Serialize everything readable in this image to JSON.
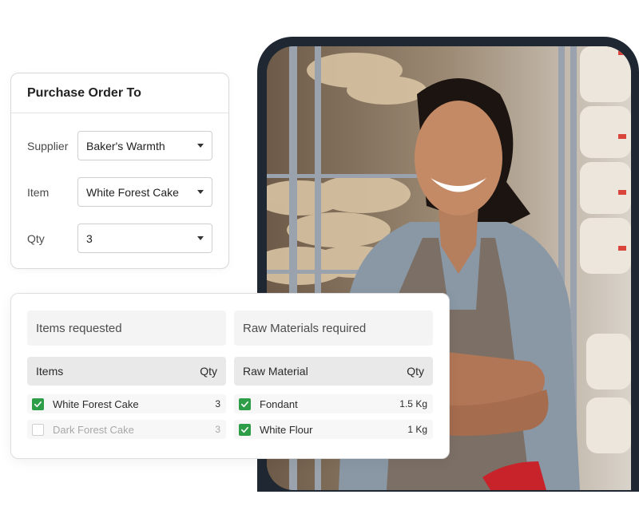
{
  "purchase_order": {
    "title": "Purchase Order To",
    "fields": [
      {
        "label": "Supplier",
        "value": "Baker's Warmth"
      },
      {
        "label": "Item",
        "value": "White Forest Cake"
      },
      {
        "label": "Qty",
        "value": "3"
      }
    ]
  },
  "items_requested": {
    "section_title": "Items requested",
    "columns": {
      "name": "Items",
      "qty": "Qty"
    },
    "rows": [
      {
        "name": "White Forest Cake",
        "qty": "3",
        "checked": true
      },
      {
        "name": "Dark Forest Cake",
        "qty": "3",
        "checked": false
      }
    ]
  },
  "raw_materials": {
    "section_title": "Raw Materials required",
    "columns": {
      "name": "Raw Material",
      "qty": "Qty"
    },
    "rows": [
      {
        "name": "Fondant",
        "qty": "1.5 Kg",
        "checked": true
      },
      {
        "name": "White Flour",
        "qty": "1 Kg",
        "checked": true
      }
    ]
  },
  "colors": {
    "check_green": "#2e9d47",
    "photo_frame": "#1f2733"
  },
  "icons": [
    "chevron-down-icon",
    "checkbox-checked-icon",
    "checkbox-unchecked-icon"
  ]
}
